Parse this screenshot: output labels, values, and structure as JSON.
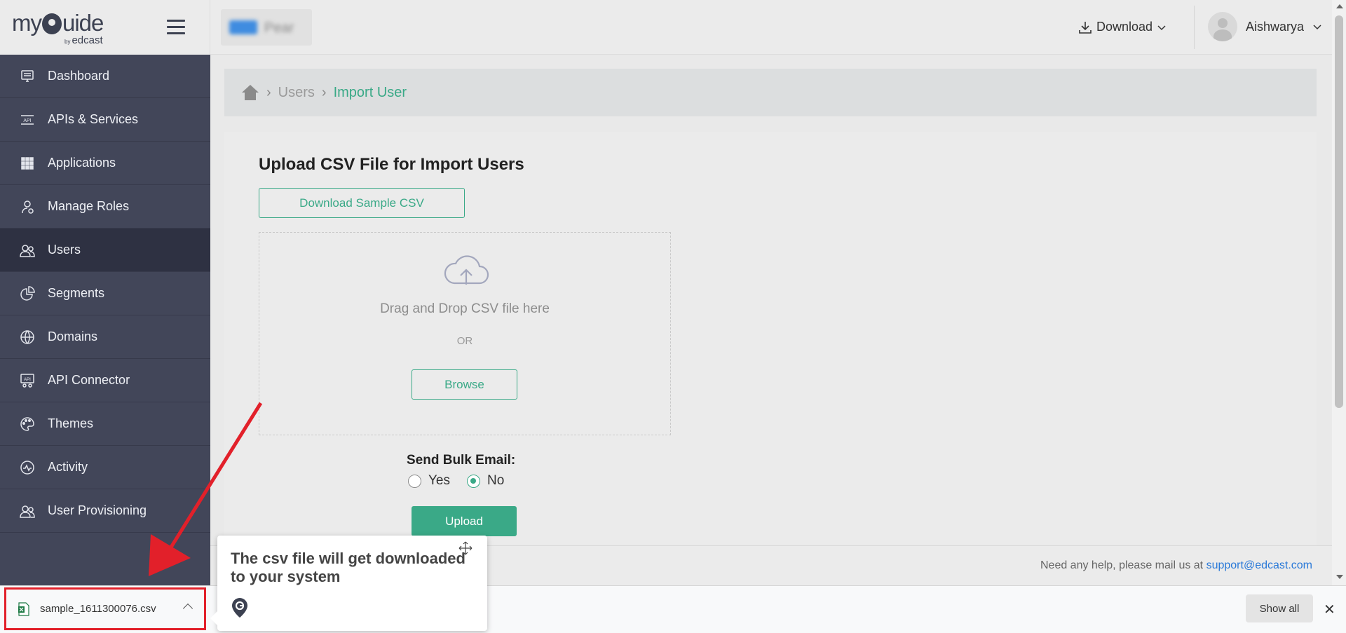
{
  "brand": {
    "logo_main": "my",
    "logo_main2": "uide",
    "logo_by": "by",
    "logo_sub": "edcast"
  },
  "header": {
    "app_name": "Pear",
    "download_label": "Download",
    "user_name": "Aishwarya"
  },
  "sidebar": {
    "items": [
      {
        "label": "Dashboard",
        "icon": "dashboard-icon"
      },
      {
        "label": "APIs & Services",
        "icon": "api-icon"
      },
      {
        "label": "Applications",
        "icon": "grid-icon"
      },
      {
        "label": "Manage Roles",
        "icon": "roles-icon"
      },
      {
        "label": "Users",
        "icon": "users-icon"
      },
      {
        "label": "Segments",
        "icon": "pie-icon"
      },
      {
        "label": "Domains",
        "icon": "globe-icon"
      },
      {
        "label": "API Connector",
        "icon": "api-connector-icon"
      },
      {
        "label": "Themes",
        "icon": "palette-icon"
      },
      {
        "label": "Activity",
        "icon": "activity-icon"
      },
      {
        "label": "User Provisioning",
        "icon": "user-provisioning-icon"
      }
    ],
    "active_index": 4
  },
  "breadcrumb": {
    "users": "Users",
    "current": "Import User"
  },
  "main": {
    "title": "Upload CSV File for Import Users",
    "download_sample": "Download Sample CSV",
    "drop_text": "Drag and Drop CSV file here",
    "or_text": "OR",
    "browse_label": "Browse",
    "bulk_label": "Send Bulk Email:",
    "yes_label": "Yes",
    "no_label": "No",
    "selected": "No",
    "upload_label": "Upload"
  },
  "footer": {
    "help_text": "Need any help, please mail us at ",
    "email": "support@edcast.com"
  },
  "download_bar": {
    "file_name": "sample_1611300076.csv",
    "show_all": "Show all",
    "close": "✕"
  },
  "tooltip": {
    "text": "The csv file will get downloaded to your system"
  },
  "colors": {
    "accent": "#3aa987",
    "sidebar_bg": "#424659",
    "highlight": "#e2202a",
    "link": "#2a79d8"
  }
}
